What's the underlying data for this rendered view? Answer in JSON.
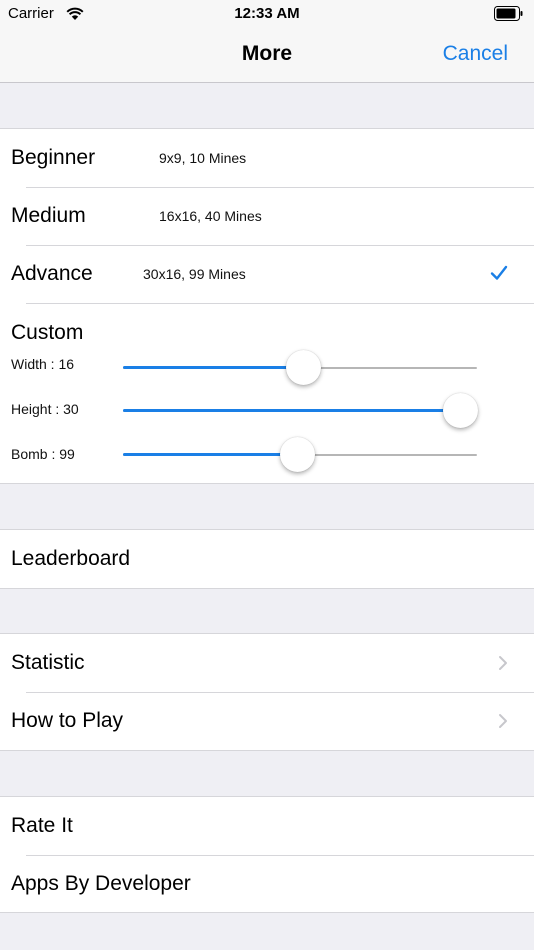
{
  "status_bar": {
    "carrier": "Carrier",
    "time": "12:33 AM"
  },
  "nav": {
    "title": "More",
    "cancel_label": "Cancel"
  },
  "levels": [
    {
      "title": "Beginner",
      "detail": "9x9, 10 Mines",
      "selected": false
    },
    {
      "title": "Medium",
      "detail": "16x16, 40 Mines",
      "selected": false
    },
    {
      "title": "Advance",
      "detail": "30x16, 99 Mines",
      "selected": true
    }
  ],
  "custom": {
    "title": "Custom",
    "sliders": [
      {
        "label": "Width : 16",
        "fraction": 0.51
      },
      {
        "label": "Height : 30",
        "fraction": 1.0
      },
      {
        "label": "Bomb : 99",
        "fraction": 0.49
      }
    ]
  },
  "leaderboard": {
    "label": "Leaderboard"
  },
  "info": {
    "statistic_label": "Statistic",
    "howto_label": "How to Play"
  },
  "misc": {
    "rate_label": "Rate It",
    "apps_label": "Apps By Developer"
  },
  "colors": {
    "accent": "#1a7fe6",
    "chevron": "#c7c7cc",
    "background": "#efeff4"
  }
}
